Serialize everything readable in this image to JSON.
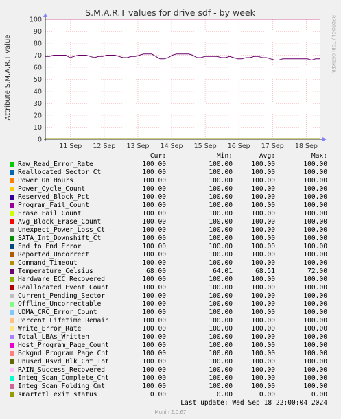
{
  "chart_data": {
    "type": "line",
    "title": "S.M.A.R.T values for drive sdf - by week",
    "ylabel": "Attribute S.M.A.R.T value",
    "xlabel": "",
    "side_label": "RRDTOOL / TOBI OETIKER",
    "ylim": [
      0,
      100
    ],
    "yticks": [
      0,
      10,
      20,
      30,
      40,
      50,
      60,
      70,
      80,
      90,
      100
    ],
    "x_categories": [
      "11 Sep",
      "12 Sep",
      "13 Sep",
      "14 Sep",
      "15 Sep",
      "16 Sep",
      "17 Sep",
      "18 Sep"
    ],
    "grid": true,
    "series_values": {
      "constant_top": 100,
      "constant_bottom": 0,
      "temperature_profile": [
        69,
        69,
        70,
        70,
        70,
        70,
        68,
        69,
        70,
        70,
        70,
        69,
        68,
        69,
        69,
        70,
        70,
        70,
        69,
        68,
        68,
        69,
        69,
        70,
        71,
        71,
        71,
        69,
        67,
        67,
        68,
        70,
        71,
        71,
        71,
        71,
        70,
        68,
        68,
        69,
        69,
        69,
        69,
        68,
        68,
        69,
        68,
        67,
        67,
        68,
        68,
        69,
        69,
        68,
        68,
        67,
        66,
        66,
        67,
        67,
        67,
        67,
        67,
        67,
        67,
        66,
        67,
        67
      ]
    }
  },
  "legend": {
    "headers": {
      "cur": "Cur:",
      "min": "Min:",
      "avg": "Avg:",
      "max": "Max:"
    },
    "rows": [
      {
        "name": "Raw_Read_Error_Rate",
        "color": "#00cc00",
        "cur": "100.00",
        "min": "100.00",
        "avg": "100.00",
        "max": "100.00"
      },
      {
        "name": "Reallocated_Sector_Ct",
        "color": "#0066b3",
        "cur": "100.00",
        "min": "100.00",
        "avg": "100.00",
        "max": "100.00"
      },
      {
        "name": "Power_On_Hours",
        "color": "#ff8000",
        "cur": "100.00",
        "min": "100.00",
        "avg": "100.00",
        "max": "100.00"
      },
      {
        "name": "Power_Cycle_Count",
        "color": "#ffcc00",
        "cur": "100.00",
        "min": "100.00",
        "avg": "100.00",
        "max": "100.00"
      },
      {
        "name": "Reserved_Block_Pct",
        "color": "#330099",
        "cur": "100.00",
        "min": "100.00",
        "avg": "100.00",
        "max": "100.00"
      },
      {
        "name": "Program_Fail_Count",
        "color": "#990099",
        "cur": "100.00",
        "min": "100.00",
        "avg": "100.00",
        "max": "100.00"
      },
      {
        "name": "Erase_Fail_Count",
        "color": "#ccff00",
        "cur": "100.00",
        "min": "100.00",
        "avg": "100.00",
        "max": "100.00"
      },
      {
        "name": "Avg_Block_Erase_Count",
        "color": "#ff0000",
        "cur": "100.00",
        "min": "100.00",
        "avg": "100.00",
        "max": "100.00"
      },
      {
        "name": "Unexpect_Power_Loss_Ct",
        "color": "#808080",
        "cur": "100.00",
        "min": "100.00",
        "avg": "100.00",
        "max": "100.00"
      },
      {
        "name": "SATA_Int_Downshift_Ct",
        "color": "#008f00",
        "cur": "100.00",
        "min": "100.00",
        "avg": "100.00",
        "max": "100.00"
      },
      {
        "name": "End_to_End_Error",
        "color": "#00487d",
        "cur": "100.00",
        "min": "100.00",
        "avg": "100.00",
        "max": "100.00"
      },
      {
        "name": "Reported_Uncorrect",
        "color": "#b35a00",
        "cur": "100.00",
        "min": "100.00",
        "avg": "100.00",
        "max": "100.00"
      },
      {
        "name": "Command_Timeout",
        "color": "#b38f00",
        "cur": "100.00",
        "min": "100.00",
        "avg": "100.00",
        "max": "100.00"
      },
      {
        "name": "Temperature_Celsius",
        "color": "#6b006b",
        "cur": "68.00",
        "min": "64.01",
        "avg": "68.51",
        "max": "72.00"
      },
      {
        "name": "Hardware_ECC_Recovered",
        "color": "#8fb300",
        "cur": "100.00",
        "min": "100.00",
        "avg": "100.00",
        "max": "100.00"
      },
      {
        "name": "Reallocated_Event_Count",
        "color": "#b30000",
        "cur": "100.00",
        "min": "100.00",
        "avg": "100.00",
        "max": "100.00"
      },
      {
        "name": "Current_Pending_Sector",
        "color": "#bebebe",
        "cur": "100.00",
        "min": "100.00",
        "avg": "100.00",
        "max": "100.00"
      },
      {
        "name": "Offline_Uncorrectable",
        "color": "#80ff80",
        "cur": "100.00",
        "min": "100.00",
        "avg": "100.00",
        "max": "100.00"
      },
      {
        "name": "UDMA_CRC_Error_Count",
        "color": "#80c9ff",
        "cur": "100.00",
        "min": "100.00",
        "avg": "100.00",
        "max": "100.00"
      },
      {
        "name": "Percent_Lifetime_Remain",
        "color": "#ffc080",
        "cur": "100.00",
        "min": "100.00",
        "avg": "100.00",
        "max": "100.00"
      },
      {
        "name": "Write_Error_Rate",
        "color": "#ffe680",
        "cur": "100.00",
        "min": "100.00",
        "avg": "100.00",
        "max": "100.00"
      },
      {
        "name": "Total_LBAs_Written",
        "color": "#aa80ff",
        "cur": "100.00",
        "min": "100.00",
        "avg": "100.00",
        "max": "100.00"
      },
      {
        "name": "Host_Program_Page_Count",
        "color": "#ee00cc",
        "cur": "100.00",
        "min": "100.00",
        "avg": "100.00",
        "max": "100.00"
      },
      {
        "name": "Bckgnd_Program_Page_Cnt",
        "color": "#ff8080",
        "cur": "100.00",
        "min": "100.00",
        "avg": "100.00",
        "max": "100.00"
      },
      {
        "name": "Unused_Rsvd_Blk_Cnt_Tot",
        "color": "#666600",
        "cur": "100.00",
        "min": "100.00",
        "avg": "100.00",
        "max": "100.00"
      },
      {
        "name": "RAIN_Success_Recovered",
        "color": "#ffbfff",
        "cur": "100.00",
        "min": "100.00",
        "avg": "100.00",
        "max": "100.00"
      },
      {
        "name": "Integ_Scan_Complete_Cnt",
        "color": "#00ffcc",
        "cur": "100.00",
        "min": "100.00",
        "avg": "100.00",
        "max": "100.00"
      },
      {
        "name": "Integ_Scan_Folding_Cnt",
        "color": "#cc6699",
        "cur": "100.00",
        "min": "100.00",
        "avg": "100.00",
        "max": "100.00"
      },
      {
        "name": "smartctl_exit_status",
        "color": "#999900",
        "cur": "0.00",
        "min": "0.00",
        "avg": "0.00",
        "max": "0.00"
      }
    ]
  },
  "last_update": "Last update: Wed Sep 18 22:00:04 2024",
  "footer": "Munin 2.0.67"
}
